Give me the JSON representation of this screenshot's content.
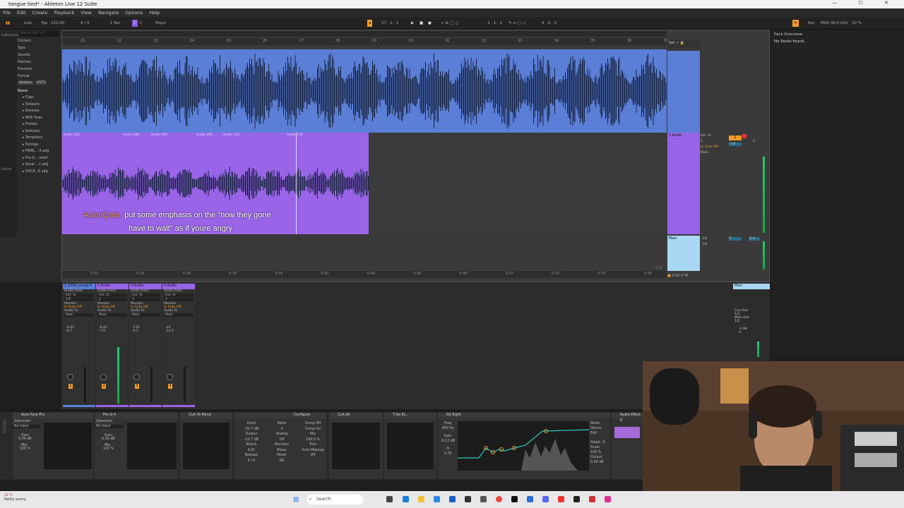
{
  "window": {
    "title": "tongue tied* - Ableton Live 12 Suite",
    "controls": "— ☐ ✕"
  },
  "menu": [
    "File",
    "Edit",
    "Create",
    "Playback",
    "View",
    "Navigate",
    "Options",
    "Help"
  ],
  "control_bar": {
    "link": "Link",
    "tap": "Tap",
    "tempo": "152.00",
    "signature": "4 / 4",
    "quantize": "1 Bar",
    "key_root": "C",
    "scale": "Major",
    "position": "27 . 1 . 1",
    "loop_start": "3 . 1 . 1",
    "loop_len": "4 . 0 . 0",
    "key_label": "Key",
    "midi_label": "MIDI",
    "sample_rate": "48.0 kHz",
    "cpu": "10 %"
  },
  "browser": {
    "search": "Search (Ctrl + F)",
    "filters": [
      "Content",
      "Type",
      "Sounds",
      "Devices",
      "Function",
      "Format"
    ],
    "format_tags": [
      "Ableton",
      "VST3"
    ],
    "name_header": "Name",
    "items": [
      "Clips",
      "Defaults",
      "Grooves",
      "MIDI Tools",
      "Presets",
      "Samples",
      "Templates",
      "Tunings",
      "FINAL ...5.adg",
      "Pro-Q ...reset",
      "Vocal ...1.adg",
      "VOCA...E.adg"
    ],
    "left_labels": [
      "Collections",
      "Places"
    ]
  },
  "ruler_top": [
    "21",
    "22",
    "23",
    "24",
    "25",
    "26",
    "27",
    "28",
    "29",
    "30",
    "31",
    "32",
    "33",
    "34",
    "35",
    "36",
    "37"
  ],
  "ruler_bottom": [
    "0:32",
    "0:34",
    "0:36",
    "0:38",
    "0:40",
    "0:42",
    "0:44",
    "0:46",
    "0:48",
    "0:50",
    "0:52",
    "0:54",
    "0:56"
  ],
  "clip_labels": [
    "Audio 202",
    "Audio 208",
    "Audio 209",
    "Audio 205",
    "Audio 153",
    "Audio 154"
  ],
  "caption": {
    "user": "AslanQara",
    "line1": "put some emphasis on the \"now they gone",
    "line2": "have to wait\" as if youre angry"
  },
  "tracks": [
    {
      "name": "2 Audio",
      "input": "Ext. In",
      "ch": "1",
      "monitor": "In Auto Off",
      "out": "Main",
      "vol": "-7.8",
      "pan": "C"
    },
    {
      "name": "Main",
      "input": "1/2",
      "out": "1/2",
      "vol": "0",
      "pan": "-6.0"
    }
  ],
  "arrangement_footer": {
    "zoom": "1/4",
    "ratio": "1/4",
    "view_btn": "0.00"
  },
  "pack_overview": {
    "title": "Pack Overview",
    "message": "No Packs found."
  },
  "mixer_strips": [
    {
      "name": "1 [VOX] young it",
      "color": "#5b7fd7",
      "audio_from": "Audio From",
      "from_val": "Ext. In",
      "ch": "1/2",
      "monitor": "Monitor",
      "audio_to": "Audio To",
      "to_val": "Main",
      "vol": "-6.83",
      "peak": "-8.7",
      "num": "1"
    },
    {
      "name": "2 Audio",
      "color": "#9a64e8",
      "audio_from": "Audio From",
      "from_val": "Ext. In",
      "ch": "1",
      "monitor": "Monitor",
      "audio_to": "Audio To",
      "to_val": "Main",
      "vol": "-6.42",
      "peak": "-7.8",
      "num": "2"
    },
    {
      "name": "3 Audio",
      "color": "#9a64e8",
      "audio_from": "Audio From",
      "from_val": "Ext. In",
      "ch": "1",
      "monitor": "Monitor",
      "audio_to": "Audio To",
      "to_val": "Main",
      "vol": "-110",
      "peak": "-9.1",
      "num": "3"
    },
    {
      "name": "4 Audio",
      "color": "#9a64e8",
      "audio_from": "Audio From",
      "from_val": "Ext. In",
      "ch": "1",
      "monitor": "Monitor",
      "audio_to": "Audio To",
      "to_val": "Main",
      "vol": "-inf",
      "peak": "-14.2",
      "num": "4"
    }
  ],
  "main_strip": {
    "name": "Main",
    "cue_out": "Cue Out",
    "cue_val": "1/2",
    "main_out": "Main Out",
    "main_val": "1/2",
    "vol": "-2.98",
    "peak": "0"
  },
  "devices": [
    {
      "name": "Auto-Tune Pro",
      "sidechain": "Sidechain",
      "input": "No Input",
      "gain": "Gain",
      "gain_val": "0.00 dB",
      "mix": "Mix",
      "mix_val": "100 %"
    },
    {
      "name": "Pro-Q 4",
      "sidechain": "Sidechain",
      "input": "No Input",
      "gain": "Gain",
      "gain_val": "0.00 dB",
      "mix": "Mix",
      "mix_val": "100 %"
    },
    {
      "name": "CLA-76 Mono",
      "configure": "Configure"
    },
    {
      "name": "CLA-2A",
      "input": "Input",
      "input_val": "-32.7 dB",
      "output": "Output",
      "output_val": "-22.7 dB",
      "attack": "Attack",
      "attack_val": "4.01",
      "release": "Release",
      "release_val": "6.73",
      "ratio": "Ratio",
      "ratio_val": "4",
      "analog": "Analog",
      "analog_val": "Off",
      "revision": "Revision",
      "bluey": "Bluey",
      "meter": "Meter",
      "meter_val": "GR",
      "comp_off": "Comp Off",
      "comp_on": "Comp On",
      "mix": "Mix",
      "mix_val": "100.0 %",
      "trim": "Trim",
      "automakeup": "Auto Makeup",
      "am_val": "Off"
    },
    {
      "name": "T-De-Es..."
    },
    {
      "name": "EQ Eight",
      "freq": "Freq",
      "freq_val": "460 Hz",
      "gain": "Gain",
      "gain_val": "-6.12 dB",
      "q": "Q",
      "q_val": "0.79",
      "mode": "Mode",
      "mode_val": "Stereo",
      "edit": "Edit",
      "adapt_q": "Adapt. Q",
      "scale": "Scale",
      "scale_val": "100 %",
      "output": "Output",
      "output_val": "0.00 dB"
    },
    {
      "name": "Audio Effect R"
    }
  ],
  "weather": {
    "temp": "21°C",
    "desc": "Partly sunny"
  },
  "taskbar": {
    "search": "Search"
  },
  "colors": {
    "blue_track": "#5b7fd7",
    "purple_track": "#9a64e8",
    "main_track": "#a8d8f4",
    "accent_orange": "#f39a28"
  }
}
